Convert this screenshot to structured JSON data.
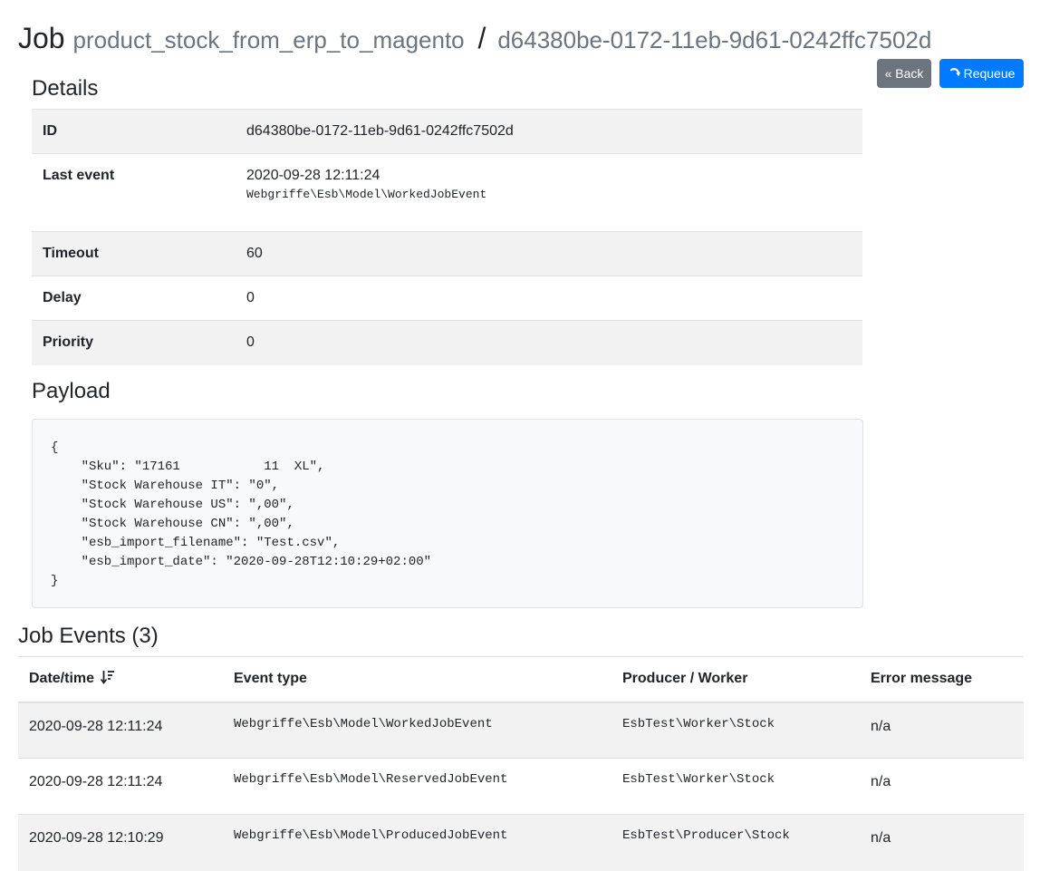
{
  "header": {
    "job_word": "Job",
    "queue_name": "product_stock_from_erp_to_magento",
    "separator": "/",
    "job_id": "d64380be-0172-11eb-9d61-0242ffc7502d"
  },
  "actions": {
    "back_label": "« Back",
    "requeue_label": "Requeue",
    "requeue_icon": "redo-icon",
    "back_color": "#6c757d",
    "requeue_color": "#007bff"
  },
  "details": {
    "title": "Details",
    "rows": [
      {
        "label": "ID",
        "value": "d64380be-0172-11eb-9d61-0242ffc7502d"
      },
      {
        "label": "Last event",
        "value": "2020-09-28 12:11:24",
        "sub": "Webgriffe\\Esb\\Model\\WorkedJobEvent"
      },
      {
        "label": "Timeout",
        "value": "60"
      },
      {
        "label": "Delay",
        "value": "0"
      },
      {
        "label": "Priority",
        "value": "0"
      }
    ]
  },
  "payload": {
    "title": "Payload",
    "content": "{\n    \"Sku\": \"17161           11  XL\",\n    \"Stock Warehouse IT\": \"0\",\n    \"Stock Warehouse US\": \",00\",\n    \"Stock Warehouse CN\": \",00\",\n    \"esb_import_filename\": \"Test.csv\",\n    \"esb_import_date\": \"2020-09-28T12:10:29+02:00\"\n}"
  },
  "events": {
    "title": "Job Events (3)",
    "sort_icon": "sort-descending-icon",
    "columns": [
      "Date/time",
      "Event type",
      "Producer / Worker",
      "Error message"
    ],
    "rows": [
      {
        "datetime": "2020-09-28 12:11:24",
        "type": "Webgriffe\\Esb\\Model\\WorkedJobEvent",
        "worker": "EsbTest\\Worker\\Stock",
        "error": "n/a"
      },
      {
        "datetime": "2020-09-28 12:11:24",
        "type": "Webgriffe\\Esb\\Model\\ReservedJobEvent",
        "worker": "EsbTest\\Worker\\Stock",
        "error": "n/a"
      },
      {
        "datetime": "2020-09-28 12:10:29",
        "type": "Webgriffe\\Esb\\Model\\ProducedJobEvent",
        "worker": "EsbTest\\Producer\\Stock",
        "error": "n/a"
      }
    ]
  }
}
